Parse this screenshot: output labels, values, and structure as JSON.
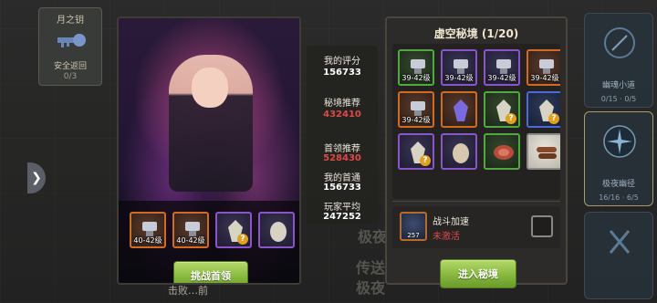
{
  "colors": {
    "accent_green": "#86b83e",
    "value_red": "#e04848",
    "panel_dark": "#2c2b29"
  },
  "left_card": {
    "title": "月之钥",
    "subtitle": "安全返回",
    "count": "0/3",
    "icon": "key-icon"
  },
  "right_tiles": [
    {
      "name": "幽魂小道",
      "stat_a": "0/15",
      "stat_b": "0/5",
      "icon": "portal-icon"
    },
    {
      "name": "极夜幽径",
      "stat_a": "16/16",
      "stat_b": "6/5",
      "icon": "star-emblem-icon"
    },
    {
      "name": "",
      "stat_a": "",
      "stat_b": "",
      "icon": "rune-icon"
    }
  ],
  "background_texts": [
    "极夜",
    "传送",
    "极夜"
  ],
  "bottom_hint": "击败…前",
  "boss": {
    "button_label": "挑战首领",
    "rewards": [
      {
        "type": "orange",
        "icon": "relic-icon",
        "level": "40-42级"
      },
      {
        "type": "orange",
        "icon": "relic-icon",
        "level": "40-42级"
      },
      {
        "type": "purple",
        "icon": "crystal-mystery-icon",
        "level": "",
        "mystery": true
      },
      {
        "type": "purple",
        "icon": "egg-icon",
        "level": ""
      }
    ]
  },
  "stats": {
    "my_score_label": "我的评分",
    "my_score": "156733",
    "recommend_label": "秘境推荐",
    "recommend": "432410",
    "boss_recommend_label": "首领推荐",
    "boss_recommend": "528430",
    "first_clear_label": "我的首通",
    "first_clear": "156733",
    "avg_label": "玩家平均",
    "avg": "247252"
  },
  "void": {
    "title": "虚空秘境 (1/20)",
    "items": [
      {
        "type": "green",
        "icon": "relic-icon",
        "level": "39-42级"
      },
      {
        "type": "purple",
        "icon": "relic-icon",
        "level": "39-42级"
      },
      {
        "type": "purple",
        "icon": "relic-icon",
        "level": "39-42级"
      },
      {
        "type": "orange",
        "icon": "relic-icon",
        "level": "39-42级"
      },
      {
        "type": "orange",
        "icon": "relic-icon",
        "level": "39-42级"
      },
      {
        "type": "orange",
        "icon": "purple-crystal-icon",
        "level": ""
      },
      {
        "type": "green",
        "icon": "crystal-mystery-icon",
        "level": "",
        "mystery": true
      },
      {
        "type": "blue",
        "icon": "crystal-mystery-icon",
        "level": "",
        "mystery": true
      },
      {
        "type": "purple",
        "icon": "crystal-mystery-icon",
        "level": "",
        "mystery": true
      },
      {
        "type": "purple",
        "icon": "egg-icon",
        "level": ""
      },
      {
        "type": "green",
        "icon": "meat-icon",
        "level": ""
      },
      {
        "type": "gray",
        "icon": "wood-icon",
        "level": ""
      }
    ],
    "speed": {
      "name": "战斗加速",
      "status": "未激活",
      "count": "257"
    },
    "button_label": "进入秘境"
  }
}
